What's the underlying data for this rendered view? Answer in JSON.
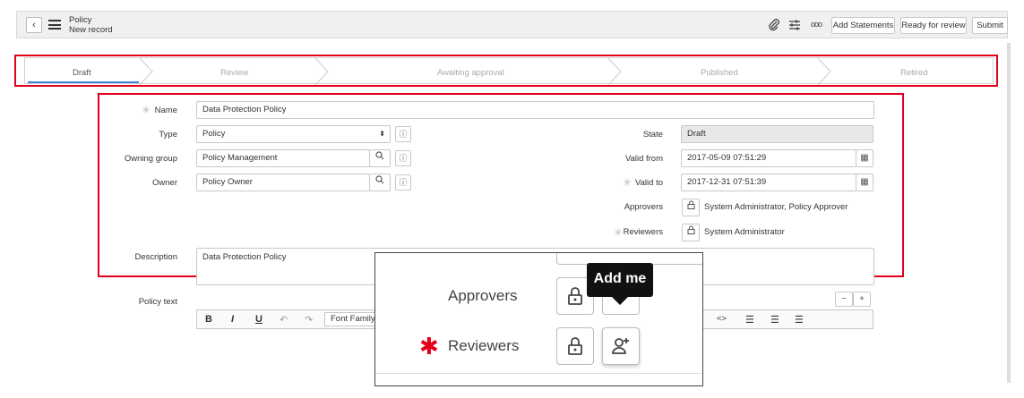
{
  "header": {
    "title": "Policy",
    "subtitle": "New record",
    "buttons": {
      "add_statements": "Add Statements",
      "ready_for_review": "Ready for review",
      "submit": "Submit"
    },
    "icons": {
      "back": "‹",
      "attachment": "📎",
      "settings": "☰",
      "more": "ooo"
    }
  },
  "stages": [
    "Draft",
    "Review",
    "Awaiting approval",
    "Published",
    "Retired"
  ],
  "form": {
    "name": {
      "label": "Name",
      "value": "Data Protection Policy"
    },
    "type": {
      "label": "Type",
      "value": "Policy"
    },
    "owning_group": {
      "label": "Owning group",
      "value": "Policy Management"
    },
    "owner": {
      "label": "Owner",
      "value": "Policy Owner"
    },
    "state": {
      "label": "State",
      "value": "Draft"
    },
    "valid_from": {
      "label": "Valid from",
      "value": "2017-05-09 07:51:29"
    },
    "valid_to": {
      "label": "Valid to",
      "value": "2017-12-31 07:51:39"
    },
    "approvers": {
      "label": "Approvers",
      "value": "System Administrator, Policy Approver"
    },
    "reviewers": {
      "label": "Reviewers",
      "value": "System Administrator"
    },
    "description": {
      "label": "Description",
      "value": "Data Protection Policy"
    },
    "policy_text": {
      "label": "Policy text"
    }
  },
  "editor": {
    "bold": "B",
    "italic": "I",
    "underline": "U",
    "font_family": "Font Family",
    "code": "<>"
  },
  "zoom": {
    "approvers_label": "Approvers",
    "reviewers_label": "Reviewers",
    "tooltip": "Add me"
  },
  "colors": {
    "highlight": "#e3001b",
    "active_stage": "#3d84d6",
    "required": "#e3001b"
  }
}
